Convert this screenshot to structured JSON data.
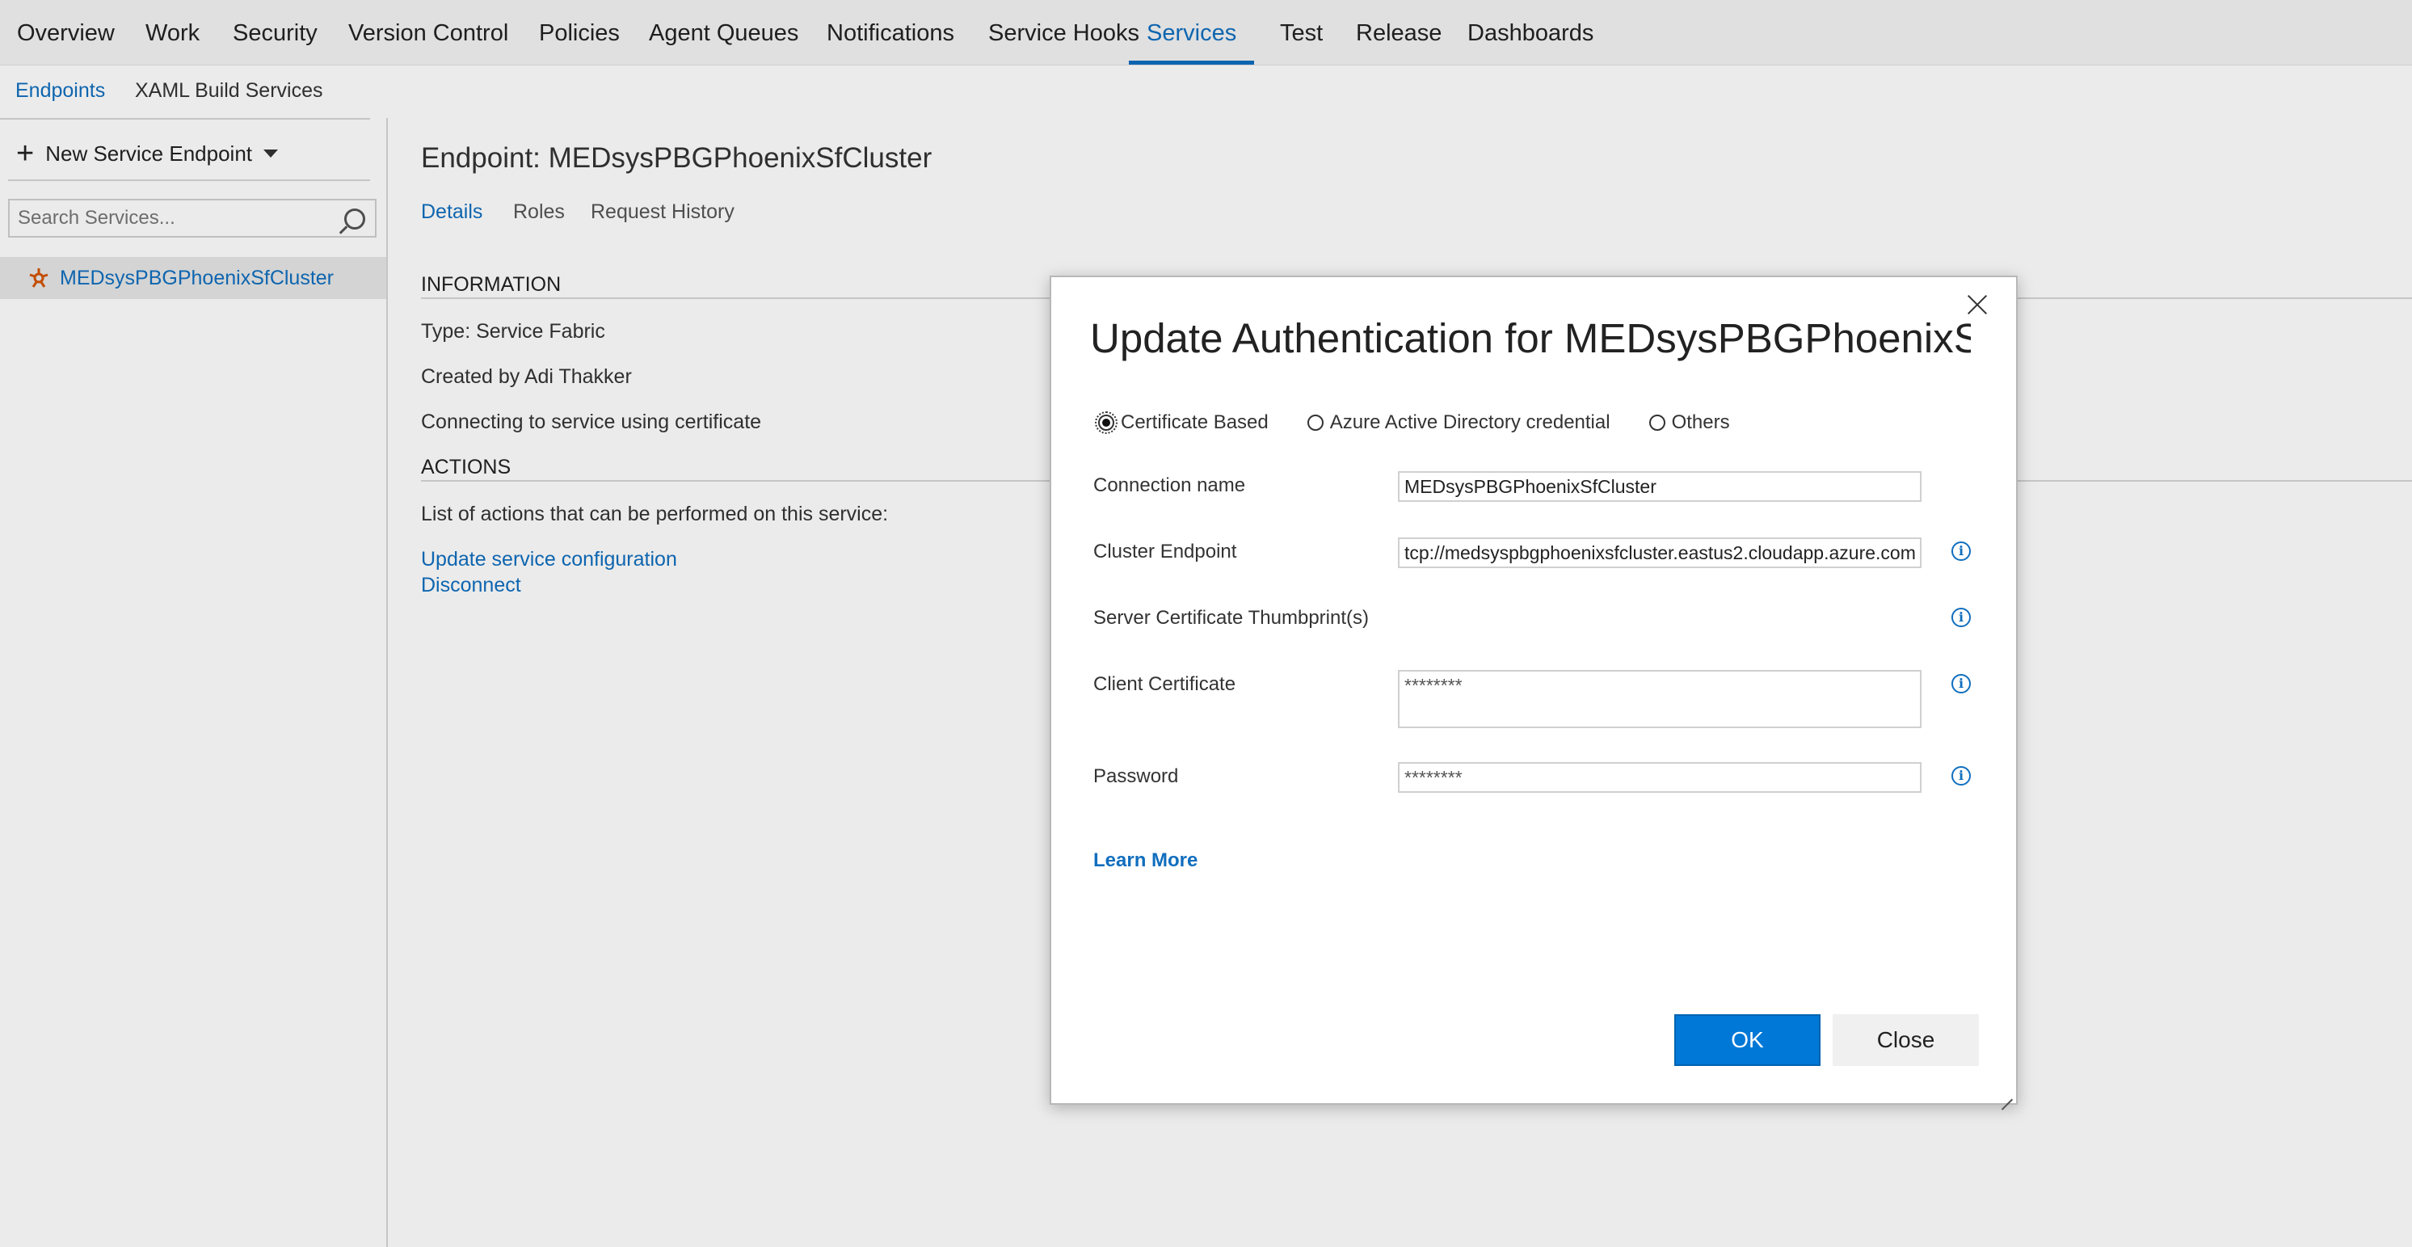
{
  "top_nav": {
    "tabs": [
      {
        "label": "Overview"
      },
      {
        "label": "Work"
      },
      {
        "label": "Security"
      },
      {
        "label": "Version Control"
      },
      {
        "label": "Policies"
      },
      {
        "label": "Agent Queues"
      },
      {
        "label": "Notifications"
      },
      {
        "label": "Service Hooks"
      },
      {
        "label": "Services"
      },
      {
        "label": "Test"
      },
      {
        "label": "Release"
      },
      {
        "label": "Dashboards"
      }
    ],
    "active": "Services"
  },
  "sub_nav": {
    "endpoints": "Endpoints",
    "xaml": "XAML Build Services"
  },
  "left_pane": {
    "new_endpoint_label": "New Service Endpoint",
    "search_placeholder": "Search Services...",
    "services": [
      {
        "name": "MEDsysPBGPhoenixSfCluster",
        "icon": "service-fabric-icon"
      }
    ]
  },
  "details": {
    "title": "Endpoint: MEDsysPBGPhoenixSfCluster",
    "tabs": [
      "Details",
      "Roles",
      "Request History"
    ],
    "information_header": "INFORMATION",
    "type": "Type: Service Fabric",
    "created_by": "Created by Adi Thakker",
    "connecting": "Connecting to service using certificate",
    "actions_header": "ACTIONS",
    "actions_desc": "List of actions that can be performed on this service:",
    "action_update": "Update service configuration",
    "action_disconnect": "Disconnect"
  },
  "dialog": {
    "title": "Update Authentication for MEDsysPBGPhoenixSfCl...",
    "auth_options": [
      {
        "label": "Certificate Based",
        "checked": true
      },
      {
        "label": "Azure Active Directory credential",
        "checked": false
      },
      {
        "label": "Others",
        "checked": false
      }
    ],
    "fields": {
      "connection_name_label": "Connection name",
      "connection_name_value": "MEDsysPBGPhoenixSfCluster",
      "cluster_endpoint_label": "Cluster Endpoint",
      "cluster_endpoint_value": "tcp://medsyspbgphoenixsfcluster.eastus2.cloudapp.azure.com",
      "thumbprint_label": "Server Certificate Thumbprint(s)",
      "client_cert_label": "Client Certificate",
      "client_cert_placeholder": "********",
      "password_label": "Password",
      "password_placeholder": "********"
    },
    "learn_more": "Learn More",
    "ok": "OK",
    "close": "Close"
  },
  "colors": {
    "accent": "#106ebe",
    "primary_button": "#0078d7",
    "nav_bg": "#f4f4f4"
  }
}
